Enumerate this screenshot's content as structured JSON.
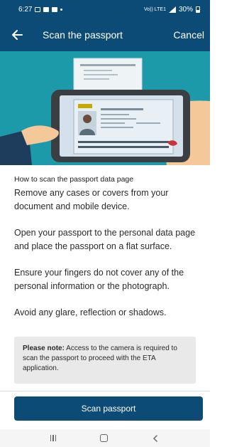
{
  "status_bar": {
    "time": "6:27",
    "signal_text": "Vo)) LTE1",
    "battery": "30%"
  },
  "app_bar": {
    "title": "Scan the passport",
    "cancel_label": "Cancel"
  },
  "content": {
    "heading": "How to scan the passport data page",
    "instructions": [
      "Remove any cases or covers from your document and mobile device.",
      "Open your passport to the personal data page and place the passport on a flat surface.",
      "Ensure your fingers do not cover any of the personal information or the photograph.",
      "Avoid any glare, reflection or shadows."
    ],
    "note_label": "Please note:",
    "note_text": " Access to the camera is required to scan the passport to proceed with the ETA application."
  },
  "actions": {
    "scan_label": "Scan passport"
  },
  "colors": {
    "primary": "#0b4b76",
    "hero_bg": "#1d9aaa",
    "note_bg": "#e9e9e9"
  },
  "icons": [
    "back-arrow-icon",
    "passport-illustration",
    "nav-recents-icon",
    "nav-home-icon",
    "nav-back-icon"
  ]
}
